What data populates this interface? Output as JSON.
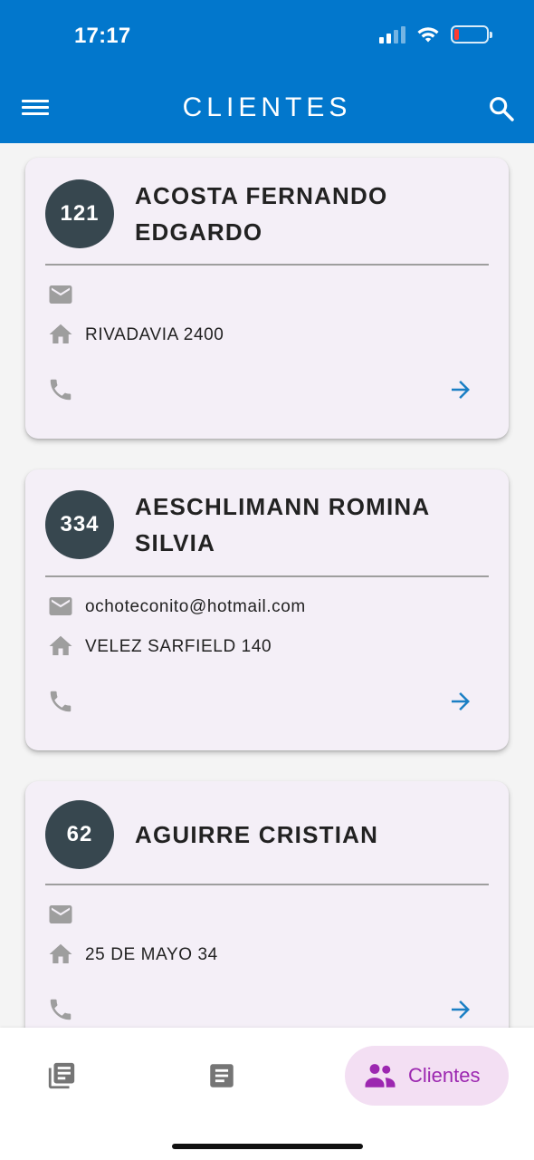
{
  "status_bar": {
    "time": "17:17"
  },
  "header": {
    "title": "CLIENTES"
  },
  "clients": [
    {
      "number": "121",
      "name": "ACOSTA FERNANDO EDGARDO",
      "email": "",
      "address": "RIVADAVIA 2400",
      "phone": ""
    },
    {
      "number": "334",
      "name": "AESCHLIMANN ROMINA SILVIA",
      "email": "ochoteconito@hotmail.com",
      "address": "VELEZ SARFIELD 140",
      "phone": ""
    },
    {
      "number": "62",
      "name": "AGUIRRE CRISTIAN",
      "email": "",
      "address": "25 DE MAYO 34",
      "phone": ""
    }
  ],
  "bottom_nav": {
    "items": [
      {
        "icon": "library-books-icon"
      },
      {
        "icon": "article-icon"
      },
      {
        "icon": "people-icon",
        "label": "Clientes",
        "active": true
      }
    ]
  },
  "colors": {
    "appbar": "#0277cc",
    "avatar": "#37474f",
    "card": "#f4eff7",
    "accent_arrow": "#1a7fc4",
    "nav_active_bg": "#f3dff3",
    "nav_active_fg": "#9c27b0"
  }
}
